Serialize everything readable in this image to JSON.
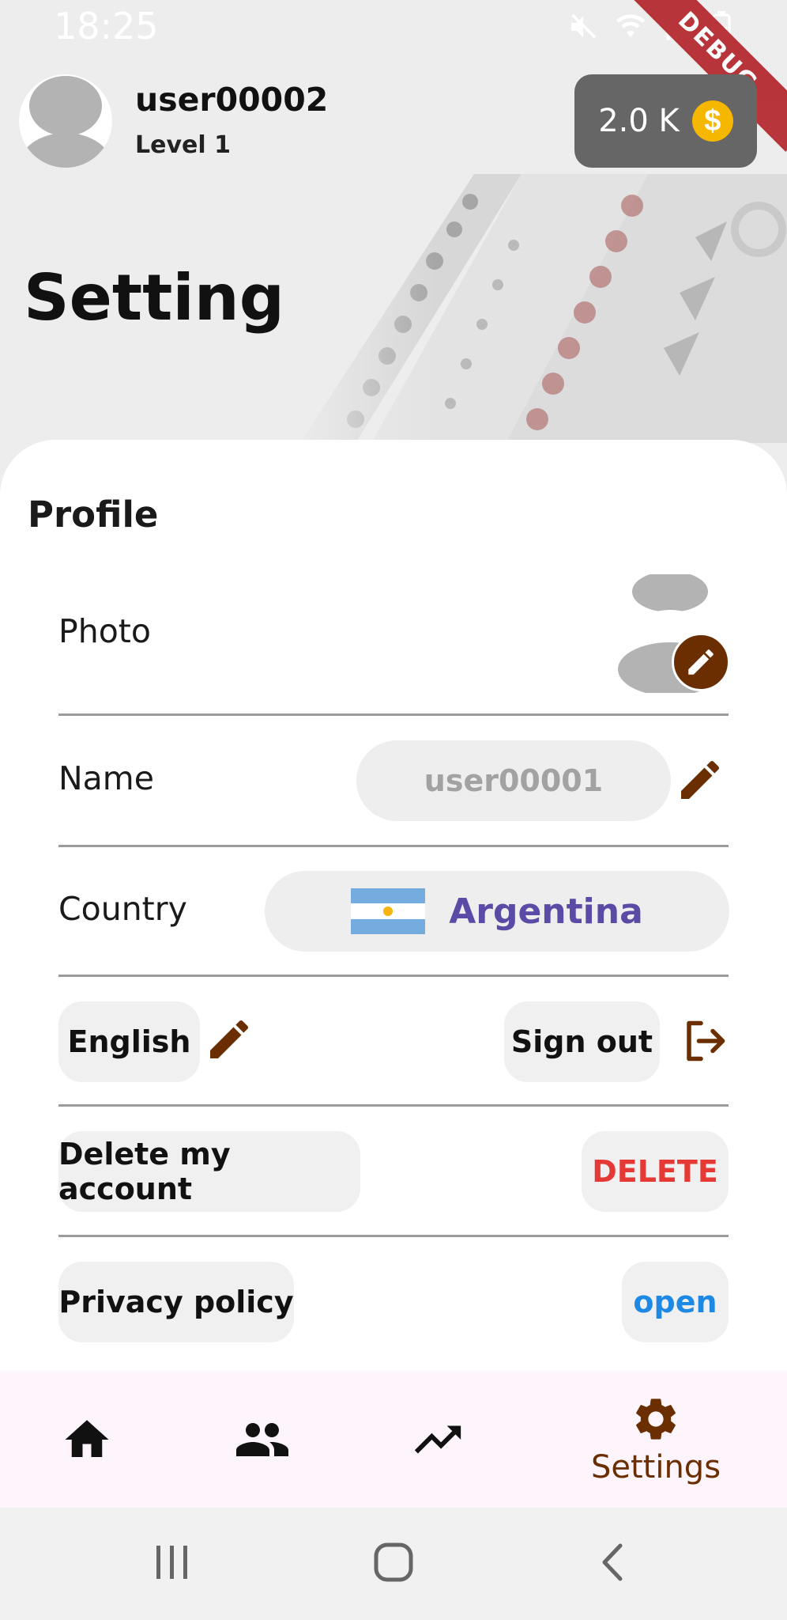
{
  "status_bar": {
    "time": "18:25"
  },
  "debug_banner": "DEBUG",
  "header": {
    "username": "user00002",
    "level": "Level 1",
    "coins": "2.0 K",
    "coin_symbol": "$"
  },
  "page_title": "Setting",
  "profile": {
    "section_title": "Profile",
    "photo_label": "Photo",
    "name_label": "Name",
    "name_value": "user00001",
    "country_label": "Country",
    "country_value": "Argentina",
    "language": "English",
    "sign_out": "Sign out",
    "delete_account": "Delete my account",
    "delete_action": "DELETE",
    "privacy_policy": "Privacy policy",
    "privacy_action": "open"
  },
  "bottom_nav": {
    "active_label": "Settings"
  },
  "colors": {
    "accent_brown": "#6a2e00",
    "danger": "#e53935",
    "link": "#1e88e5",
    "country_text": "#5b4aa6",
    "coin": "#f5b700"
  }
}
